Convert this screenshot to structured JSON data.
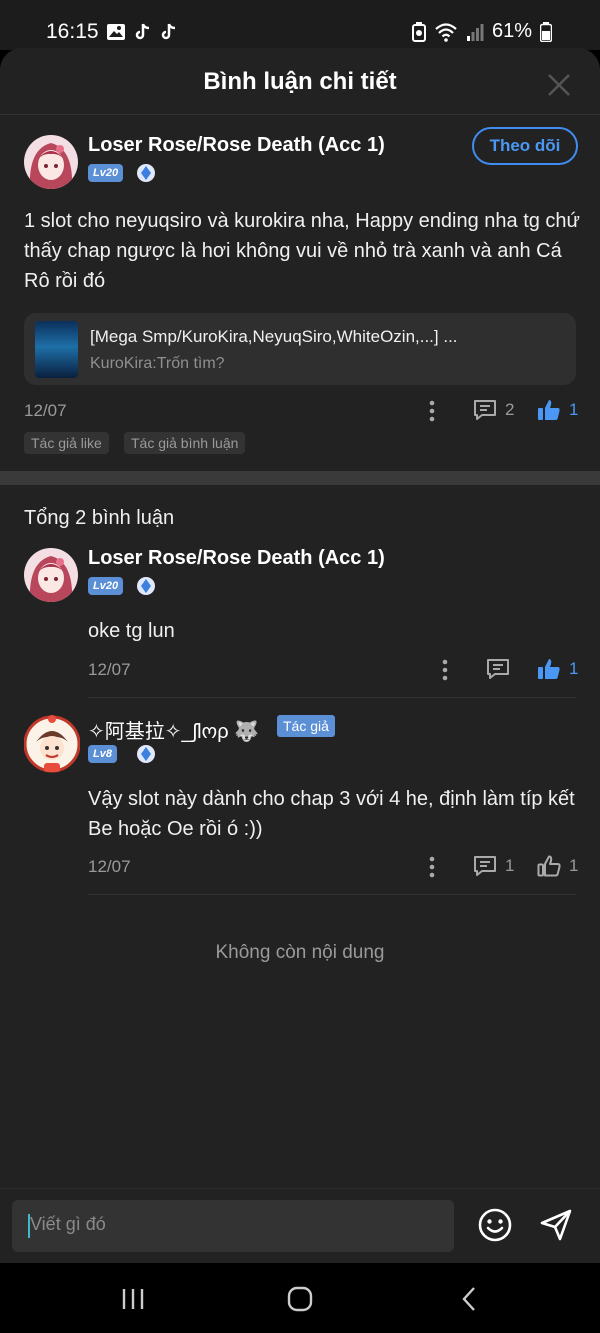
{
  "status_bar": {
    "time": "16:15",
    "battery": "61%"
  },
  "header": {
    "title": "Bình luận chi tiết"
  },
  "main_comment": {
    "username": "Loser Rose/Rose Death (Acc 1)",
    "level": "Lv20",
    "follow_label": "Theo dõi",
    "text": "1 slot cho neyuqsiro và kurokira nha, Happy ending nha tg chứ thấy chap ngược là hơi không vui về nhỏ trà xanh và anh Cá Rô rồi đó",
    "story": {
      "title": "[Mega Smp/KuroKira,NeyuqSiro,WhiteOzin,...] ...",
      "subtitle": "KuroKira:Trốn tìm?"
    },
    "date": "12/07",
    "reply_count": "2",
    "like_count": "1",
    "tags": [
      "Tác giả like",
      "Tác giả bình luận"
    ]
  },
  "total_label": "Tổng 2 bình luận",
  "replies": [
    {
      "username": "Loser Rose/Rose Death (Acc 1)",
      "level": "Lv20",
      "text": "oke tg lun",
      "date": "12/07",
      "like_count": "1"
    },
    {
      "username": "✧阿基拉✧_ʃƖოρ 🐺",
      "author_badge": "Tác giả",
      "level": "Lv8",
      "text": "Vậy slot này dành cho chap 3 với 4 he, định làm típ kết Be hoặc Oe rồi ó :))",
      "date": "12/07",
      "reply_count": "1",
      "like_count": "1"
    }
  ],
  "end_label": "Không còn nội dung",
  "input": {
    "placeholder": "Viết gì đó"
  },
  "colors": {
    "accent": "#4b97f5",
    "background": "#222222",
    "badge": "#5b8fd6"
  }
}
